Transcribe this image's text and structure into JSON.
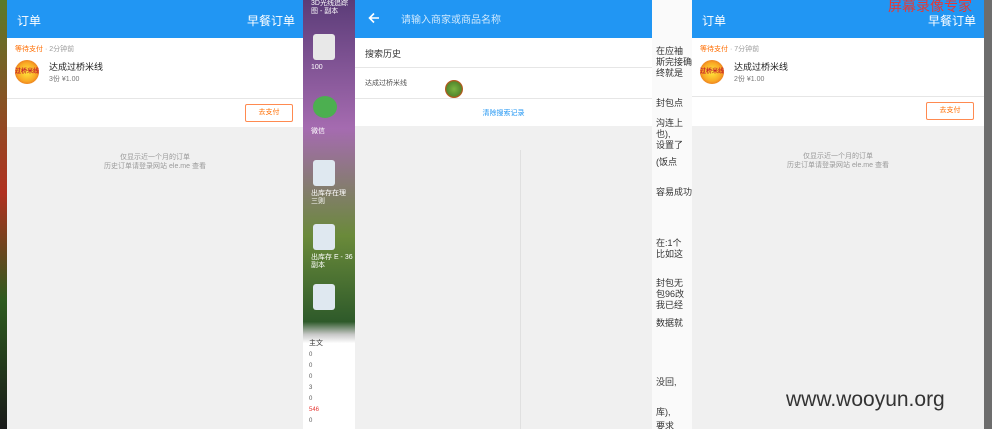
{
  "left_panel": {
    "title": "订单",
    "right_action": "早餐订单",
    "order": {
      "status_label": "等待支付",
      "status_time": "· 2分钟前",
      "logo_text": "过桥米线",
      "shop_name": "达成过桥米线",
      "summary": "3份 ¥1.00",
      "pay_button": "去支付"
    },
    "notice_line1": "仅显示近一个月的订单",
    "notice_line2": "历史订单请登录网站 ele.me 查看"
  },
  "middle_panel": {
    "search_placeholder": "请输入商家或商品名称",
    "history_title": "搜索历史",
    "history_items": [
      "达成过桥米线"
    ],
    "clear_history": "清除搜索记录"
  },
  "right_panel": {
    "title": "订单",
    "right_action": "早餐订单",
    "order": {
      "status_label": "等待支付",
      "status_time": "· 7分钟前",
      "logo_text": "过桥米线",
      "shop_name": "达成过桥米线",
      "summary": "2份 ¥1.00",
      "pay_button": "去支付"
    },
    "notice_line1": "仅显示近一个月的订单",
    "notice_line2": "历史订单请登录网站 ele.me 查看"
  },
  "desktop": {
    "top_label": "3D光线追踪\n图 - 副本",
    "icon1_label": "100",
    "icon2_label": "微信",
    "icon3_label": "出库存在理\n三则",
    "icon4_label": "出库存 E - 36\n副本",
    "table_header": "主文",
    "rows": [
      "0",
      "0",
      "0",
      "3",
      "0",
      "546",
      "0"
    ]
  },
  "doc_fragments": [
    "在应袖",
    "斯完接确",
    "终就是",
    "封包点",
    "沟连上",
    "也),",
    "设置了",
    "(饭点",
    "容易成功",
    "在:1个",
    "比如这",
    "封包无",
    "包96改",
    "我已经",
    "数据就",
    "没回,",
    "库),",
    "要求"
  ],
  "watermarks": {
    "top": "屏幕录像专家",
    "bottom": "www.wooyun.org"
  },
  "colors": {
    "app_bar": "#2196f3",
    "pending": "#ff6d00",
    "link": "#2196f3"
  },
  "icons": [
    "back-arrow-icon",
    "shop-logo-icon",
    "mouse-cursor-icon"
  ]
}
